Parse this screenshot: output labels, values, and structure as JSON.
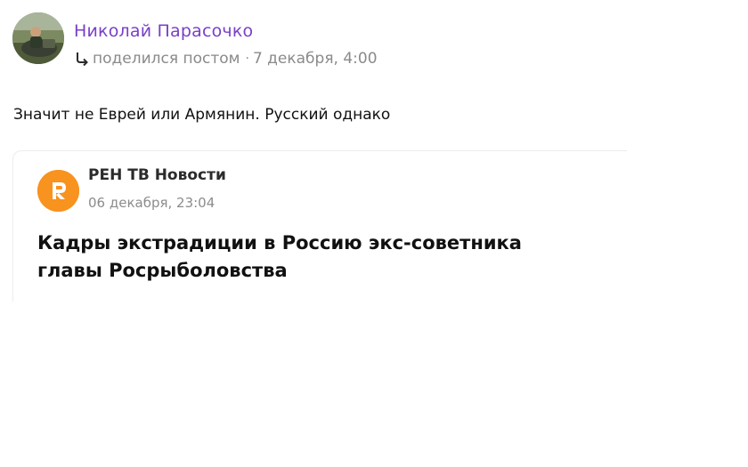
{
  "post": {
    "author": "Николай Парасочко",
    "action": "поделился постом",
    "separator": "·",
    "timestamp": "7 декабря, 4:00",
    "text": "Значит не Еврей или Армянин. Русский однако"
  },
  "shared": {
    "source_name": "РЕН ТВ Новости",
    "source_date": "06 декабря, 23:04",
    "headline": "Кадры экстрадиции в Россию экс-советника главы Росрыболовства"
  },
  "icons": {
    "share": "share-arrow-icon",
    "source_logo": "ren-tv-logo-icon"
  },
  "colors": {
    "author": "#7a3fc7",
    "meta": "#8a8a8a",
    "brand": "#f7931e"
  }
}
